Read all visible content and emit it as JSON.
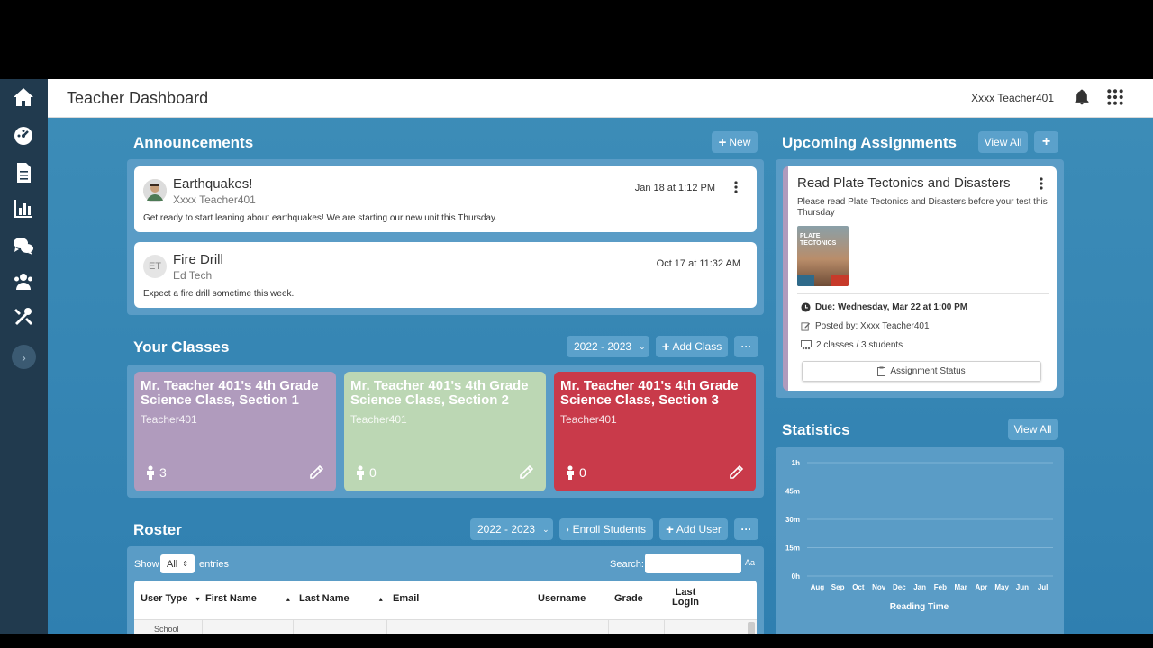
{
  "header": {
    "title": "Teacher Dashboard",
    "user": "Xxxx Teacher401"
  },
  "sidebar": {
    "items": [
      {
        "icon": "home-icon"
      },
      {
        "icon": "dashboard-gauge-icon"
      },
      {
        "icon": "document-icon"
      },
      {
        "icon": "chart-icon"
      },
      {
        "icon": "chat-icon"
      },
      {
        "icon": "users-icon"
      },
      {
        "icon": "tools-icon"
      }
    ],
    "expand": "›"
  },
  "announcements": {
    "title": "Announcements",
    "new_label": "New",
    "items": [
      {
        "title": "Earthquakes!",
        "author": "Xxxx Teacher401",
        "date": "Jan 18 at 1:12 PM",
        "body": "Get ready to start leaning about earthquakes! We are starting our new unit this Thursday.",
        "avatar": ""
      },
      {
        "title": "Fire Drill",
        "author": "Ed Tech",
        "date": "Oct 17 at 11:32 AM",
        "body": "Expect a fire drill sometime this week.",
        "avatar": "ET"
      }
    ]
  },
  "classes": {
    "title": "Your Classes",
    "year": "2022 - 2023",
    "add_label": "Add Class",
    "more_label": "···",
    "items": [
      {
        "name": "Mr. Teacher 401's 4th Grade Science Class, Section 1",
        "teacher": "Teacher401",
        "count": "3",
        "color": "#b09bbd"
      },
      {
        "name": "Mr. Teacher 401's 4th Grade Science Class, Section 2",
        "teacher": "Teacher401",
        "count": "0",
        "color": "#bcd7b4"
      },
      {
        "name": "Mr. Teacher 401's 4th Grade Science Class, Section 3",
        "teacher": "Teacher401",
        "count": "0",
        "color": "#c93a4a"
      }
    ]
  },
  "roster": {
    "title": "Roster",
    "year": "2022 - 2023",
    "enroll_label": "Enroll Students",
    "add_label": "Add User",
    "more_label": "···",
    "show_label": "Show",
    "show_value": "All",
    "entries_label": "entries",
    "search_label": "Search:",
    "search_value": "",
    "aa_label": "Aa",
    "columns": [
      "User Type",
      "First Name",
      "Last Name",
      "Email",
      "Username",
      "Grade",
      "Last Login"
    ],
    "first_row_type": "School"
  },
  "assignments": {
    "title": "Upcoming Assignments",
    "view_all": "View All",
    "add_label": "+",
    "item": {
      "title": "Read Plate Tectonics and Disasters",
      "desc": "Please read Plate Tectonics and Disasters before your test this Thursday",
      "cover_text": "PLATE TECTONICS",
      "due": "Due: Wednesday, Mar 22 at 1:00 PM",
      "posted": "Posted by: Xxxx Teacher401",
      "classes": "2 classes / 3 students",
      "status_button": "Assignment Status"
    }
  },
  "statistics": {
    "title": "Statistics",
    "view_all": "View All"
  },
  "chart_data": {
    "type": "bar",
    "title": "",
    "xlabel": "Reading Time",
    "ylabel": "",
    "categories": [
      "Aug",
      "Sep",
      "Oct",
      "Nov",
      "Dec",
      "Jan",
      "Feb",
      "Mar",
      "Apr",
      "May",
      "Jun",
      "Jul"
    ],
    "y_ticks": [
      "0h",
      "15m",
      "30m",
      "45m",
      "1h"
    ],
    "values": [
      0,
      0,
      0,
      0,
      0,
      0,
      0,
      0,
      0,
      0,
      0,
      0
    ],
    "ylim": [
      0,
      60
    ],
    "grid": true
  }
}
